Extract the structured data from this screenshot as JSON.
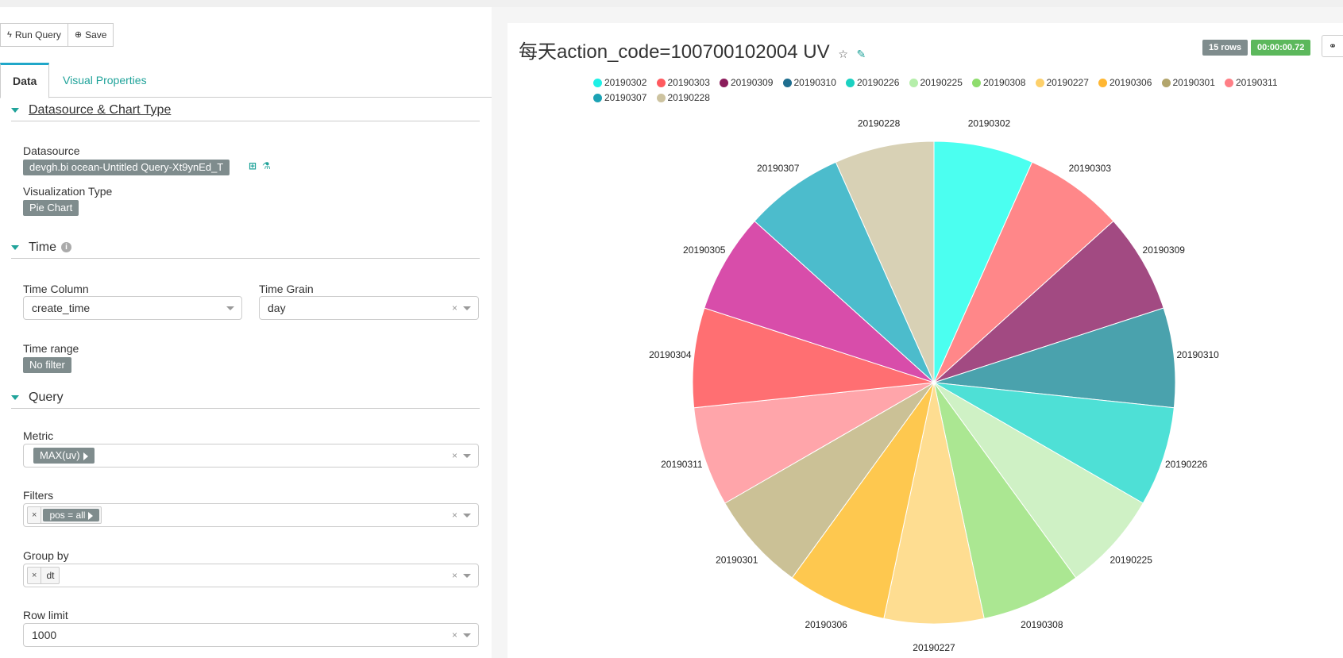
{
  "toolbar": {
    "run_label": "Run Query",
    "save_label": "Save"
  },
  "tabs": [
    {
      "label": "Data"
    },
    {
      "label": "Visual Properties"
    }
  ],
  "sections": {
    "datasource": {
      "title": "Datasource & Chart Type",
      "datasource_label": "Datasource",
      "datasource_value": "devgh.bi ocean-Untitled Query-Xt9ynEd_T",
      "viz_label": "Visualization Type",
      "viz_value": "Pie Chart"
    },
    "time": {
      "title": "Time",
      "column_label": "Time Column",
      "column_value": "create_time",
      "grain_label": "Time Grain",
      "grain_value": "day",
      "range_label": "Time range",
      "range_value": "No filter"
    },
    "query": {
      "title": "Query",
      "metric_label": "Metric",
      "metric_value": "MAX(uv)",
      "filters_label": "Filters",
      "filter_value": "pos = all",
      "groupby_label": "Group by",
      "groupby_value": "dt",
      "rowlimit_label": "Row limit",
      "rowlimit_value": "1000"
    }
  },
  "chart_header": {
    "title": "每天action_code=100700102004 UV",
    "rows_badge": "15 rows",
    "time_badge": "00:00:00.72",
    "colors": {
      "rows": "#7f8c8d",
      "time": "#5cb85c"
    }
  },
  "chart_data": {
    "type": "pie",
    "title": "每天action_code=100700102004 UV",
    "legend_placement": "top",
    "legend": [
      {
        "name": "20190302",
        "color": "#1ff0e6"
      },
      {
        "name": "20190303",
        "color": "#ff5a5f"
      },
      {
        "name": "20190309",
        "color": "#8b1d5c"
      },
      {
        "name": "20190310",
        "color": "#1f6e8f"
      },
      {
        "name": "20190226",
        "color": "#1bd1c1"
      },
      {
        "name": "20190225",
        "color": "#b5eeaa"
      },
      {
        "name": "20190308",
        "color": "#8fdd6e"
      },
      {
        "name": "20190227",
        "color": "#fdd06a"
      },
      {
        "name": "20190306",
        "color": "#ffb733"
      },
      {
        "name": "20190301",
        "color": "#b2a56c"
      },
      {
        "name": "20190311",
        "color": "#ff7f86"
      },
      {
        "name": "20190307",
        "color": "#1ca2b4"
      },
      {
        "name": "20190228",
        "color": "#cdc3a0"
      }
    ],
    "slices": [
      {
        "label": "20190302",
        "value": 1,
        "color": "#4bfff0"
      },
      {
        "label": "20190303",
        "value": 1,
        "color": "#ff8789"
      },
      {
        "label": "20190309",
        "value": 1,
        "color": "#a24a82"
      },
      {
        "label": "20190310",
        "value": 1,
        "color": "#4aa2ad"
      },
      {
        "label": "20190226",
        "value": 1,
        "color": "#4ee0d6"
      },
      {
        "label": "20190225",
        "value": 1,
        "color": "#cff1c5"
      },
      {
        "label": "20190308",
        "value": 1,
        "color": "#abe792"
      },
      {
        "label": "20190227",
        "value": 1,
        "color": "#fedd91"
      },
      {
        "label": "20190306",
        "value": 1,
        "color": "#fec84f"
      },
      {
        "label": "20190301",
        "value": 1,
        "color": "#cbc196"
      },
      {
        "label": "20190311",
        "value": 1,
        "color": "#ffa5aa"
      },
      {
        "label": "20190304",
        "value": 1,
        "color": "#ff6f72"
      },
      {
        "label": "20190305",
        "value": 1,
        "color": "#d84daa"
      },
      {
        "label": "20190307",
        "value": 1,
        "color": "#4cbccc"
      },
      {
        "label": "20190228",
        "value": 1,
        "color": "#d8d1b5"
      }
    ]
  }
}
